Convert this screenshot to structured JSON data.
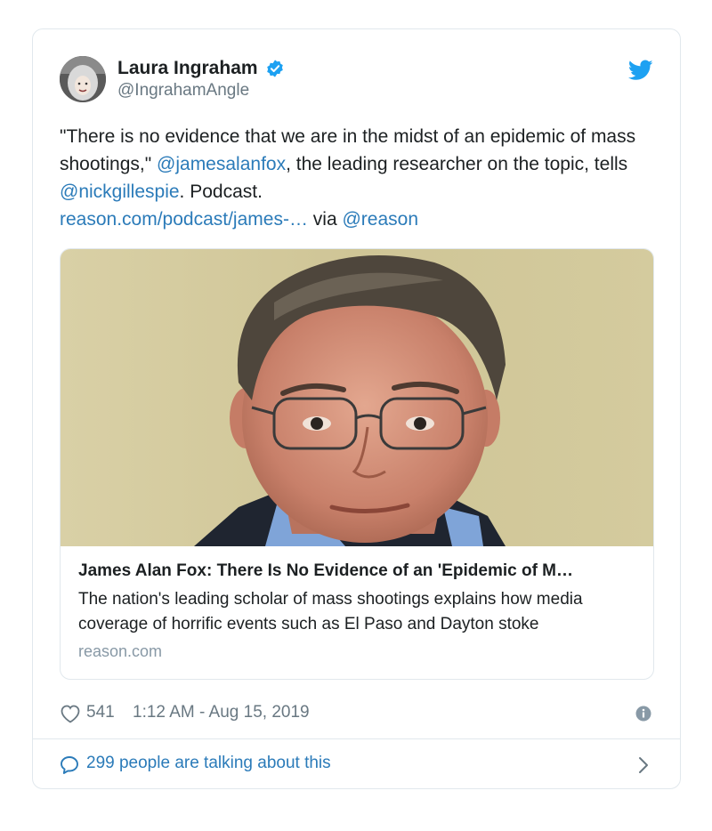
{
  "author": {
    "display_name": "Laura Ingraham",
    "handle": "@IngrahamAngle",
    "verified_icon": "verified-check-icon"
  },
  "tweet": {
    "text_part1": "\"There is no evidence that we are in the midst of an epidemic of mass shootings,\" ",
    "mention1": "@jamesalanfox",
    "text_part2": ", the leading researcher on the topic, tells ",
    "mention2": "@nickgillespie",
    "text_part3": ". Podcast.",
    "link": "reason.com/podcast/james-…",
    "text_via": " via ",
    "mention3": "@reason"
  },
  "card": {
    "title": "James Alan Fox: There Is No Evidence of an 'Epidemic of M…",
    "description": "The nation's leading scholar of mass shootings explains how media coverage of horrific events such as El Paso and Dayton stoke",
    "domain": "reason.com"
  },
  "meta": {
    "likes": "541",
    "timestamp": "1:12 AM - Aug 15, 2019"
  },
  "footer": {
    "talking": "299 people are talking about this"
  },
  "colors": {
    "link": "#2b7bb9",
    "twitter_blue": "#1da1f2",
    "muted": "#697882",
    "border": "#e1e8ed"
  }
}
